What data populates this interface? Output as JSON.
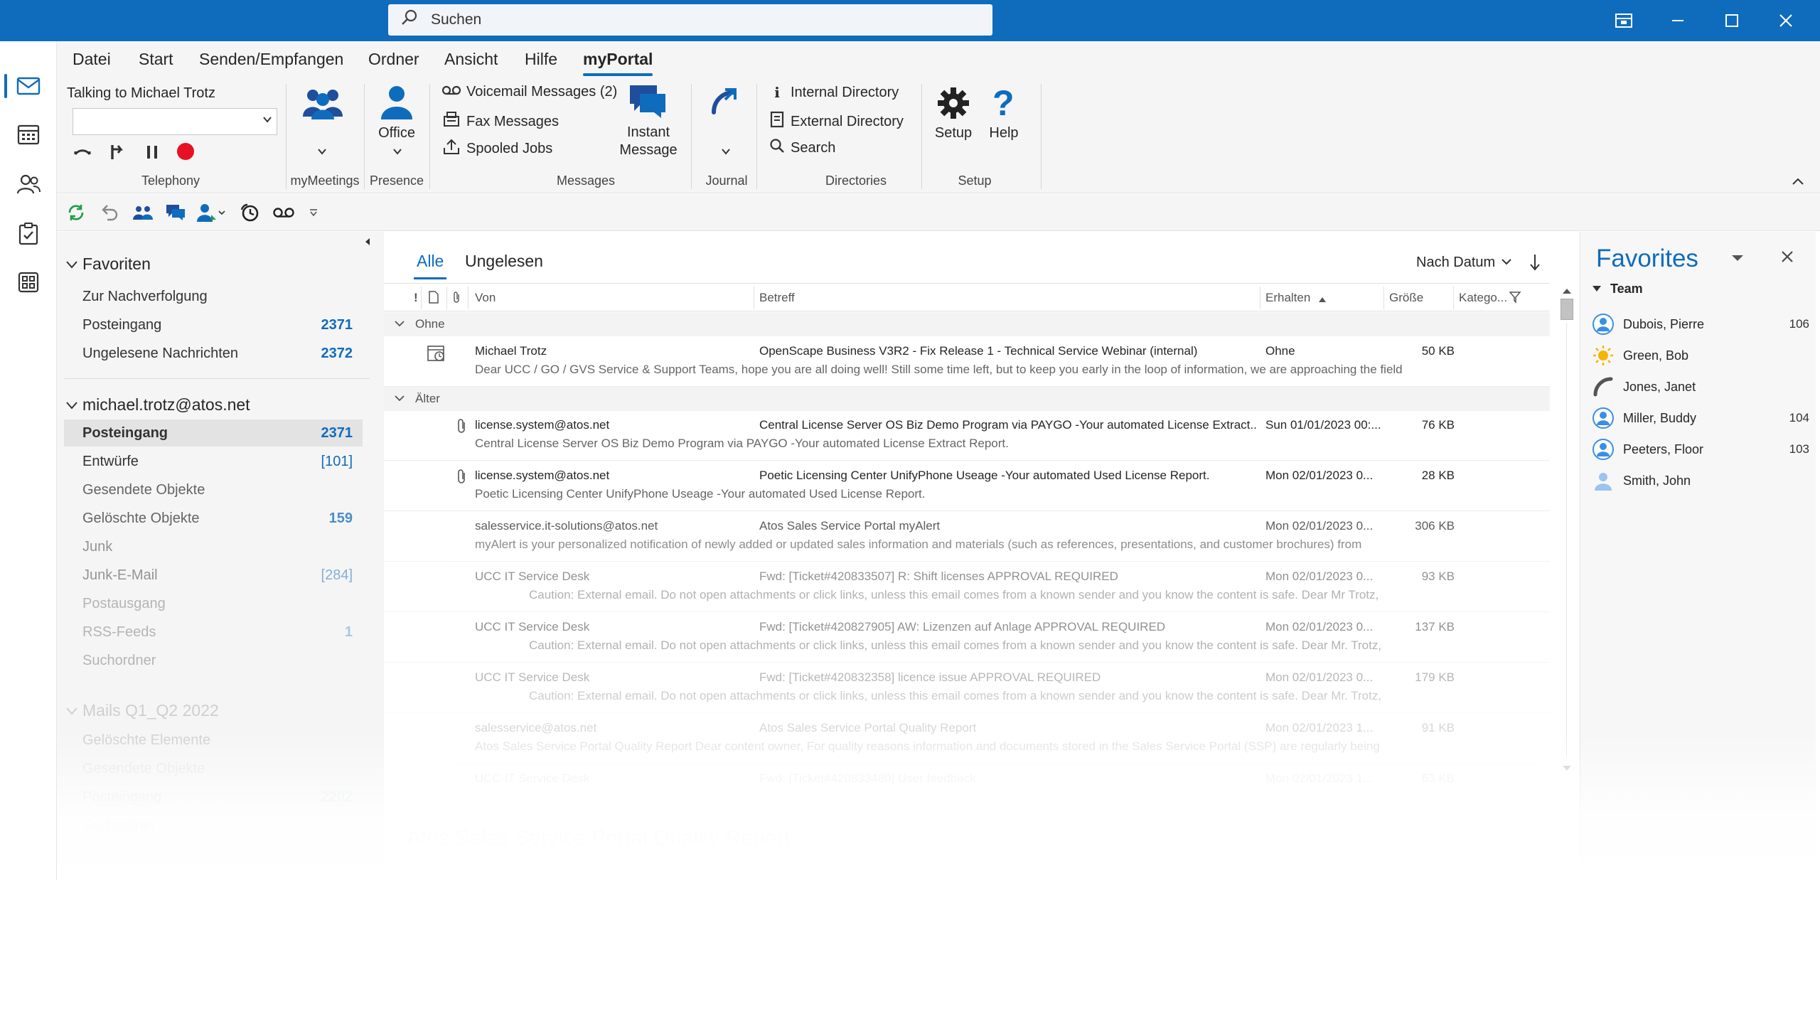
{
  "titlebar": {
    "search_placeholder": "Suchen",
    "accent": "#0f6cbd"
  },
  "menu": {
    "tabs": [
      "Datei",
      "Start",
      "Senden/Empfangen",
      "Ordner",
      "Ansicht",
      "Hilfe",
      "myPortal"
    ],
    "active": "myPortal"
  },
  "ribbon": {
    "telephony": {
      "talking_label": "Talking to Michael Trotz",
      "group_label": "Telephony"
    },
    "mymeetings": {
      "group_label": "myMeetings"
    },
    "presence": {
      "office_label": "Office",
      "group_label": "Presence"
    },
    "messages": {
      "voicemail": "Voicemail Messages (2)",
      "fax": "Fax Messages",
      "spooled": "Spooled Jobs",
      "instant": "Instant Message",
      "group_label": "Messages"
    },
    "journal": {
      "group_label": "Journal"
    },
    "directories": {
      "internal": "Internal Directory",
      "external": "External Directory",
      "search": "Search",
      "group_label": "Directories"
    },
    "setup": {
      "setup_label": "Setup",
      "help_label": "Help",
      "group_label": "Setup"
    }
  },
  "folders": {
    "favorites_header": "Favoriten",
    "favorites": [
      {
        "label": "Zur Nachverfolgung",
        "count": ""
      },
      {
        "label": "Posteingang",
        "count": "2371"
      },
      {
        "label": "Ungelesene Nachrichten",
        "count": "2372"
      }
    ],
    "account_header": "michael.trotz@atos.net",
    "account": [
      {
        "label": "Posteingang",
        "count": "2371"
      },
      {
        "label": "Entwürfe",
        "count": "[101]"
      },
      {
        "label": "Gesendete Objekte",
        "count": ""
      },
      {
        "label": "Gelöschte Objekte",
        "count": "159"
      },
      {
        "label": "Junk",
        "count": ""
      },
      {
        "label": "Junk-E-Mail",
        "count": "[284]"
      },
      {
        "label": "Postausgang",
        "count": ""
      },
      {
        "label": "RSS-Feeds",
        "count": "1"
      },
      {
        "label": "Suchordner",
        "count": ""
      }
    ],
    "archive_header": "Mails Q1_Q2 2022",
    "archive": [
      {
        "label": "Gelöschte Elemente",
        "count": ""
      },
      {
        "label": "Gesendete Objekte",
        "count": ""
      },
      {
        "label": "Posteingang",
        "count": "2202"
      },
      {
        "label": "Suchordner",
        "count": ""
      }
    ]
  },
  "list": {
    "tabs": [
      "Alle",
      "Ungelesen"
    ],
    "sort_label": "Nach Datum",
    "columns": {
      "importance": "!",
      "from": "Von",
      "subject": "Betreff",
      "received": "Erhalten",
      "size": "Größe",
      "category": "Katego..."
    },
    "group_none": "Ohne",
    "group_older": "Älter",
    "rows_none": [
      {
        "from": "Michael Trotz",
        "subject": "OpenScape Business V3R2 - Fix Release 1 - Technical Service Webinar (internal)",
        "received": "Ohne",
        "size": "50 KB",
        "preview": "Dear UCC / GO / GVS Service & Support Teams,  hope you are all doing well!  Still some time left, but to keep you early in the loop of information, we are approaching the field"
      }
    ],
    "rows_older": [
      {
        "from": "license.system@atos.net",
        "subject": "Central License Server OS Biz Demo Program via PAYGO -Your automated License Extract...",
        "received": "Sun 01/01/2023 00:...",
        "size": "76 KB",
        "preview": "Central License Server OS Biz Demo Program via PAYGO -Your automated License Extract Report."
      },
      {
        "from": "license.system@atos.net",
        "subject": "Poetic Licensing Center UnifyPhone Useage -Your automated Used License Report.",
        "received": "Mon 02/01/2023 0...",
        "size": "28 KB",
        "preview": "Poetic Licensing Center UnifyPhone Useage -Your automated Used License Report."
      },
      {
        "from": "salesservice.it-solutions@atos.net",
        "subject": "Atos Sales Service Portal myAlert",
        "received": "Mon 02/01/2023 0...",
        "size": "306 KB",
        "preview": "myAlert is your personalized notification of newly added or updated sales information and materials (such as references, presentations, and customer brochures) from"
      },
      {
        "from": "UCC IT Service Desk",
        "subject": "Fwd: [Ticket#420833507] R: Shift licenses APPROVAL REQUIRED",
        "received": "Mon 02/01/2023 0...",
        "size": "93 KB",
        "preview": "Caution: External email. Do not open attachments or click links, unless this email comes from a known sender and you know the content is safe.   Dear Mr Trotz,"
      },
      {
        "from": "UCC IT Service Desk",
        "subject": "Fwd: [Ticket#420827905] AW: Lizenzen auf Anlage APPROVAL REQUIRED",
        "received": "Mon 02/01/2023 0...",
        "size": "137 KB",
        "preview": "Caution: External email. Do not open attachments or click links, unless this email comes from a known sender and you know the content is safe.   Dear Mr. Trotz,"
      },
      {
        "from": "UCC IT Service Desk",
        "subject": "Fwd: [Ticket#420832358] licence issue APPROVAL REQUIRED",
        "received": "Mon 02/01/2023 0...",
        "size": "179 KB",
        "preview": "Caution: External email. Do not open attachments or click links, unless this email comes from a known sender and you know the content is safe.   Dear Mr. Trotz,"
      },
      {
        "from": "salesservice@atos.net",
        "subject": "Atos Sales Service Portal Quality Report",
        "received": "Mon 02/01/2023 1...",
        "size": "91 KB",
        "preview": "Atos Sales Service Portal Quality Report  Dear content owner,  For quality reasons information and documents stored in the Sales Service Portal (SSP) are regularly being"
      },
      {
        "from": "UCC IT Service Desk",
        "subject": "Fwd: [Ticket#420833480] User feedback",
        "received": "Mon 02/01/2023 1...",
        "size": "63 KB",
        "preview": ""
      }
    ],
    "reading_title": "Atos Sales Service Portal Quality Report"
  },
  "favorites_pane": {
    "title": "Favorites",
    "group": "Team",
    "contacts": [
      {
        "name": "Dubois, Pierre",
        "count": "106",
        "status": "available"
      },
      {
        "name": "Green, Bob",
        "count": "",
        "status": "away"
      },
      {
        "name": "Jones, Janet",
        "count": "",
        "status": "on-phone"
      },
      {
        "name": "Miller, Buddy",
        "count": "104",
        "status": "available"
      },
      {
        "name": "Peeters, Floor",
        "count": "103",
        "status": "available"
      },
      {
        "name": "Smith, John",
        "count": "",
        "status": "offline"
      }
    ]
  }
}
